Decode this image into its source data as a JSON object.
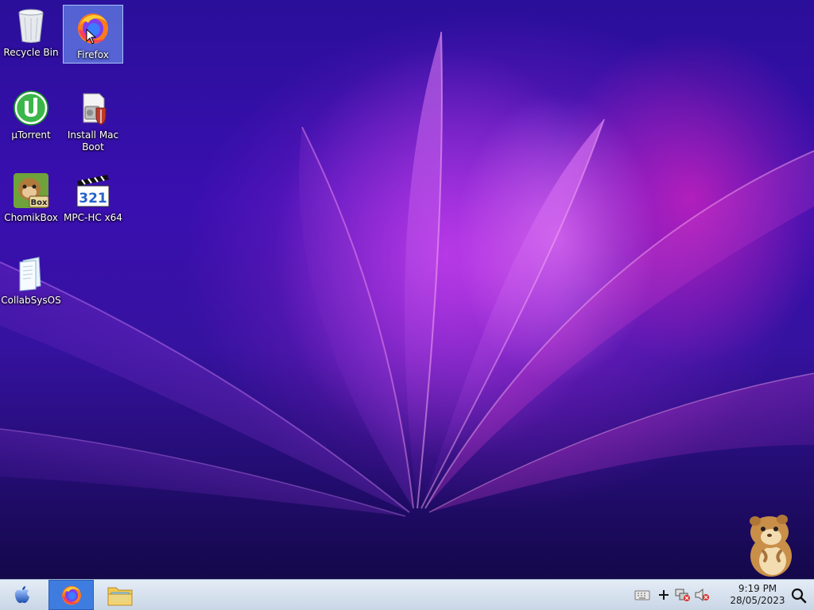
{
  "desktop": {
    "icons": [
      {
        "label": "Recycle Bin",
        "icon": "recycle-bin-icon"
      },
      {
        "label": "Firefox",
        "icon": "firefox-icon",
        "selected": true
      },
      {
        "label": "µTorrent",
        "icon": "utorrent-icon"
      },
      {
        "label": "Install Mac Boot",
        "icon": "installer-shield-icon"
      },
      {
        "label": "ChomikBox",
        "icon": "chomikbox-icon",
        "badge": "Box"
      },
      {
        "label": "MPC-HC x64",
        "icon": "mpc-hc-icon",
        "badge": "321"
      },
      {
        "label": "CollabSysOS",
        "icon": "documents-icon"
      }
    ]
  },
  "taskbar": {
    "start_icon": "apple-icon",
    "pinned": [
      {
        "name": "Firefox",
        "icon": "firefox-icon",
        "active": true
      },
      {
        "name": "File Explorer",
        "icon": "folder-icon",
        "active": false
      }
    ],
    "tray": [
      "keyboard-icon",
      "plus-icon",
      "network-disconnected-icon",
      "volume-muted-icon"
    ],
    "clock": {
      "time": "9:19 PM",
      "date": "28/05/2023"
    }
  },
  "colors": {
    "wallpaper_base": "#2a0f9a",
    "wallpaper_accent": "#e844e0",
    "taskbar": "#d7e1ee",
    "selection": "#78aaff"
  }
}
